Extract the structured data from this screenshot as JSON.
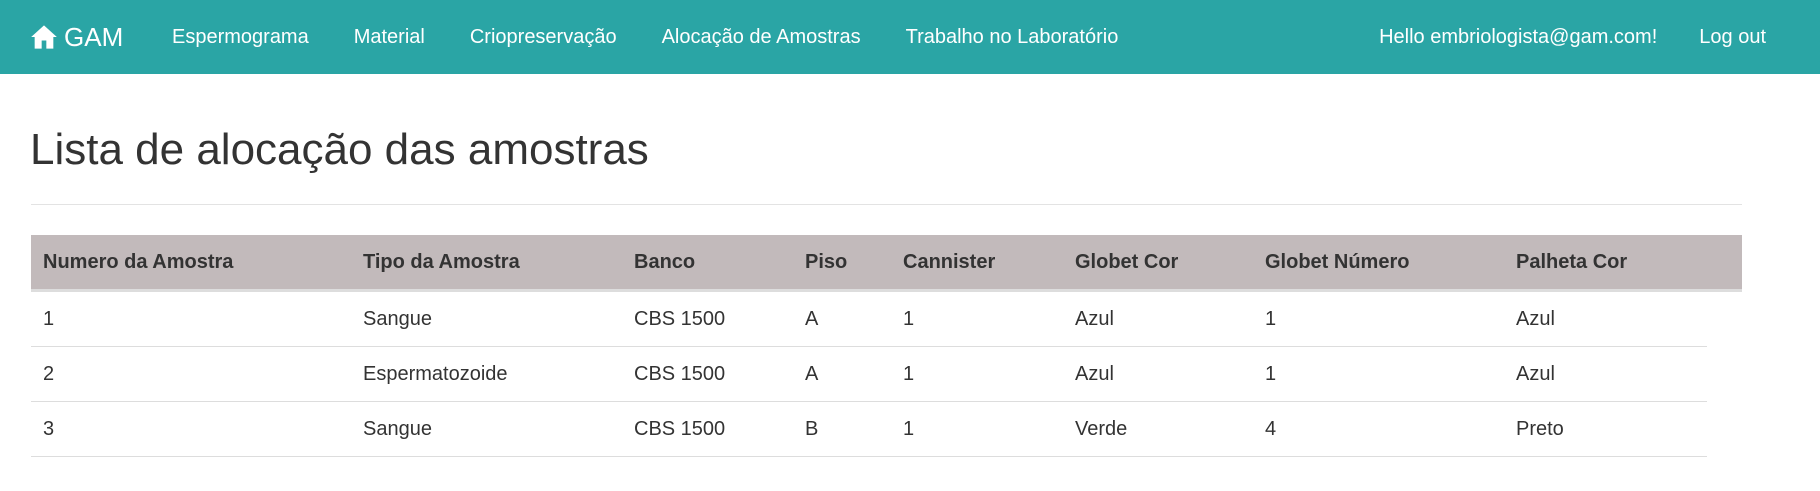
{
  "navbar": {
    "brand_icon": "home-icon",
    "brand_label": "GAM",
    "items": [
      {
        "label": "Espermograma"
      },
      {
        "label": "Material"
      },
      {
        "label": "Criopreservação"
      },
      {
        "label": "Alocação de Amostras"
      },
      {
        "label": "Trabalho no Laboratório"
      }
    ],
    "greeting": "Hello embriologista@gam.com!",
    "logout_label": "Log out",
    "background_color": "#2aa5a5"
  },
  "page": {
    "title": "Lista de alocação das amostras"
  },
  "table": {
    "header_color": "#c2babb",
    "columns": [
      "Numero da Amostra",
      "Tipo da Amostra",
      "Banco",
      "Piso",
      "Cannister",
      "Globet Cor",
      "Globet Número",
      "Palheta Cor"
    ],
    "rows": [
      [
        "1",
        "Sangue",
        "CBS 1500",
        "A",
        "1",
        "Azul",
        "1",
        "Azul"
      ],
      [
        "2",
        "Espermatozoide",
        "CBS 1500",
        "A",
        "1",
        "Azul",
        "1",
        "Azul"
      ],
      [
        "3",
        "Sangue",
        "CBS 1500",
        "B",
        "1",
        "Verde",
        "4",
        "Preto"
      ]
    ]
  }
}
